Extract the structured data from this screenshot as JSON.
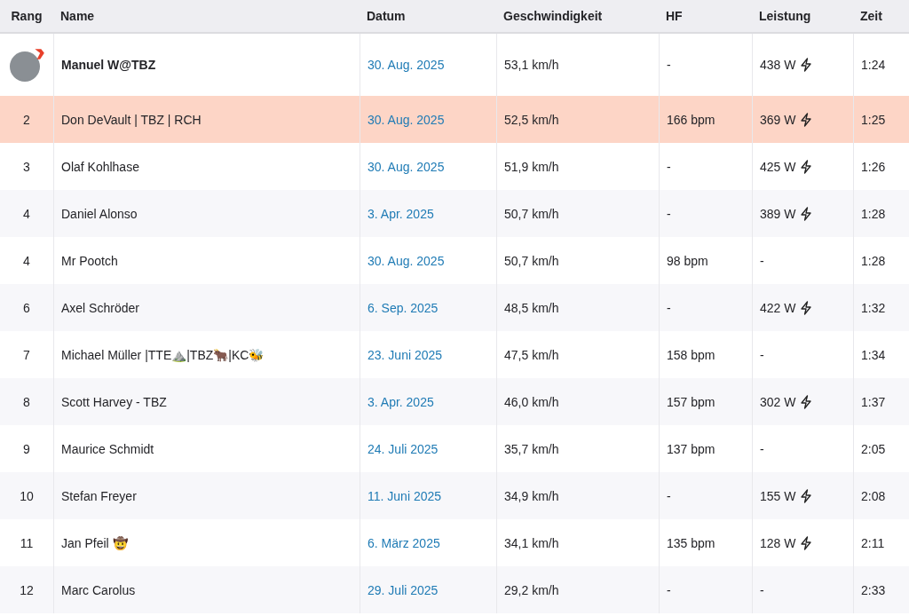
{
  "table": {
    "columns": [
      "Rang",
      "Name",
      "Datum",
      "Geschwindigkeit",
      "HF",
      "Leistung",
      "Zeit"
    ],
    "rows": [
      {
        "kind": "avatar",
        "rank": "",
        "name": "Manuel W@TBZ",
        "date": "30. Aug. 2025",
        "speed": "53,1 km/h",
        "hr": "-",
        "power": "438 W",
        "power_icon": true,
        "time": "1:24",
        "highlighted": false
      },
      {
        "kind": "rank",
        "rank": "2",
        "name": "Don DeVault | TBZ | RCH",
        "date": "30. Aug. 2025",
        "speed": "52,5 km/h",
        "hr": "166 bpm",
        "power": "369 W",
        "power_icon": true,
        "time": "1:25",
        "highlighted": true
      },
      {
        "kind": "rank",
        "rank": "3",
        "name": "Olaf Kohlhase",
        "date": "30. Aug. 2025",
        "speed": "51,9 km/h",
        "hr": "-",
        "power": "425 W",
        "power_icon": true,
        "time": "1:26",
        "highlighted": false
      },
      {
        "kind": "rank",
        "rank": "4",
        "name": "Daniel Alonso",
        "date": "3. Apr. 2025",
        "speed": "50,7 km/h",
        "hr": "-",
        "power": "389 W",
        "power_icon": true,
        "time": "1:28",
        "highlighted": false
      },
      {
        "kind": "rank",
        "rank": "4",
        "name": "Mr Pootch",
        "date": "30. Aug. 2025",
        "speed": "50,7 km/h",
        "hr": "98 bpm",
        "power": "-",
        "power_icon": false,
        "time": "1:28",
        "highlighted": false
      },
      {
        "kind": "rank",
        "rank": "6",
        "name": "Axel Schröder",
        "date": "6. Sep. 2025",
        "speed": "48,5 km/h",
        "hr": "-",
        "power": "422 W",
        "power_icon": true,
        "time": "1:32",
        "highlighted": false
      },
      {
        "kind": "rank",
        "rank": "7",
        "name": "Michael Müller |TTE⛰️|TBZ🐂|KC🐝",
        "date": "23. Juni 2025",
        "speed": "47,5 km/h",
        "hr": "158 bpm",
        "power": "-",
        "power_icon": false,
        "time": "1:34",
        "highlighted": false
      },
      {
        "kind": "rank",
        "rank": "8",
        "name": "Scott Harvey - TBZ",
        "date": "3. Apr. 2025",
        "speed": "46,0 km/h",
        "hr": "157 bpm",
        "power": "302 W",
        "power_icon": true,
        "time": "1:37",
        "highlighted": false
      },
      {
        "kind": "rank",
        "rank": "9",
        "name": "Maurice Schmidt",
        "date": "24. Juli 2025",
        "speed": "35,7 km/h",
        "hr": "137 bpm",
        "power": "-",
        "power_icon": false,
        "time": "2:05",
        "highlighted": false
      },
      {
        "kind": "rank",
        "rank": "10",
        "name": "Stefan Freyer",
        "date": "11. Juni 2025",
        "speed": "34,9 km/h",
        "hr": "-",
        "power": "155 W",
        "power_icon": true,
        "time": "2:08",
        "highlighted": false
      },
      {
        "kind": "rank",
        "rank": "11",
        "name": "Jan Pfeil 🤠",
        "date": "6. März 2025",
        "speed": "34,1 km/h",
        "hr": "135 bpm",
        "power": "128 W",
        "power_icon": true,
        "time": "2:11",
        "highlighted": false
      },
      {
        "kind": "rank",
        "rank": "12",
        "name": "Marc Carolus",
        "date": "29. Juli 2025",
        "speed": "29,2 km/h",
        "hr": "-",
        "power": "-",
        "power_icon": false,
        "time": "2:33",
        "highlighted": false
      }
    ]
  }
}
